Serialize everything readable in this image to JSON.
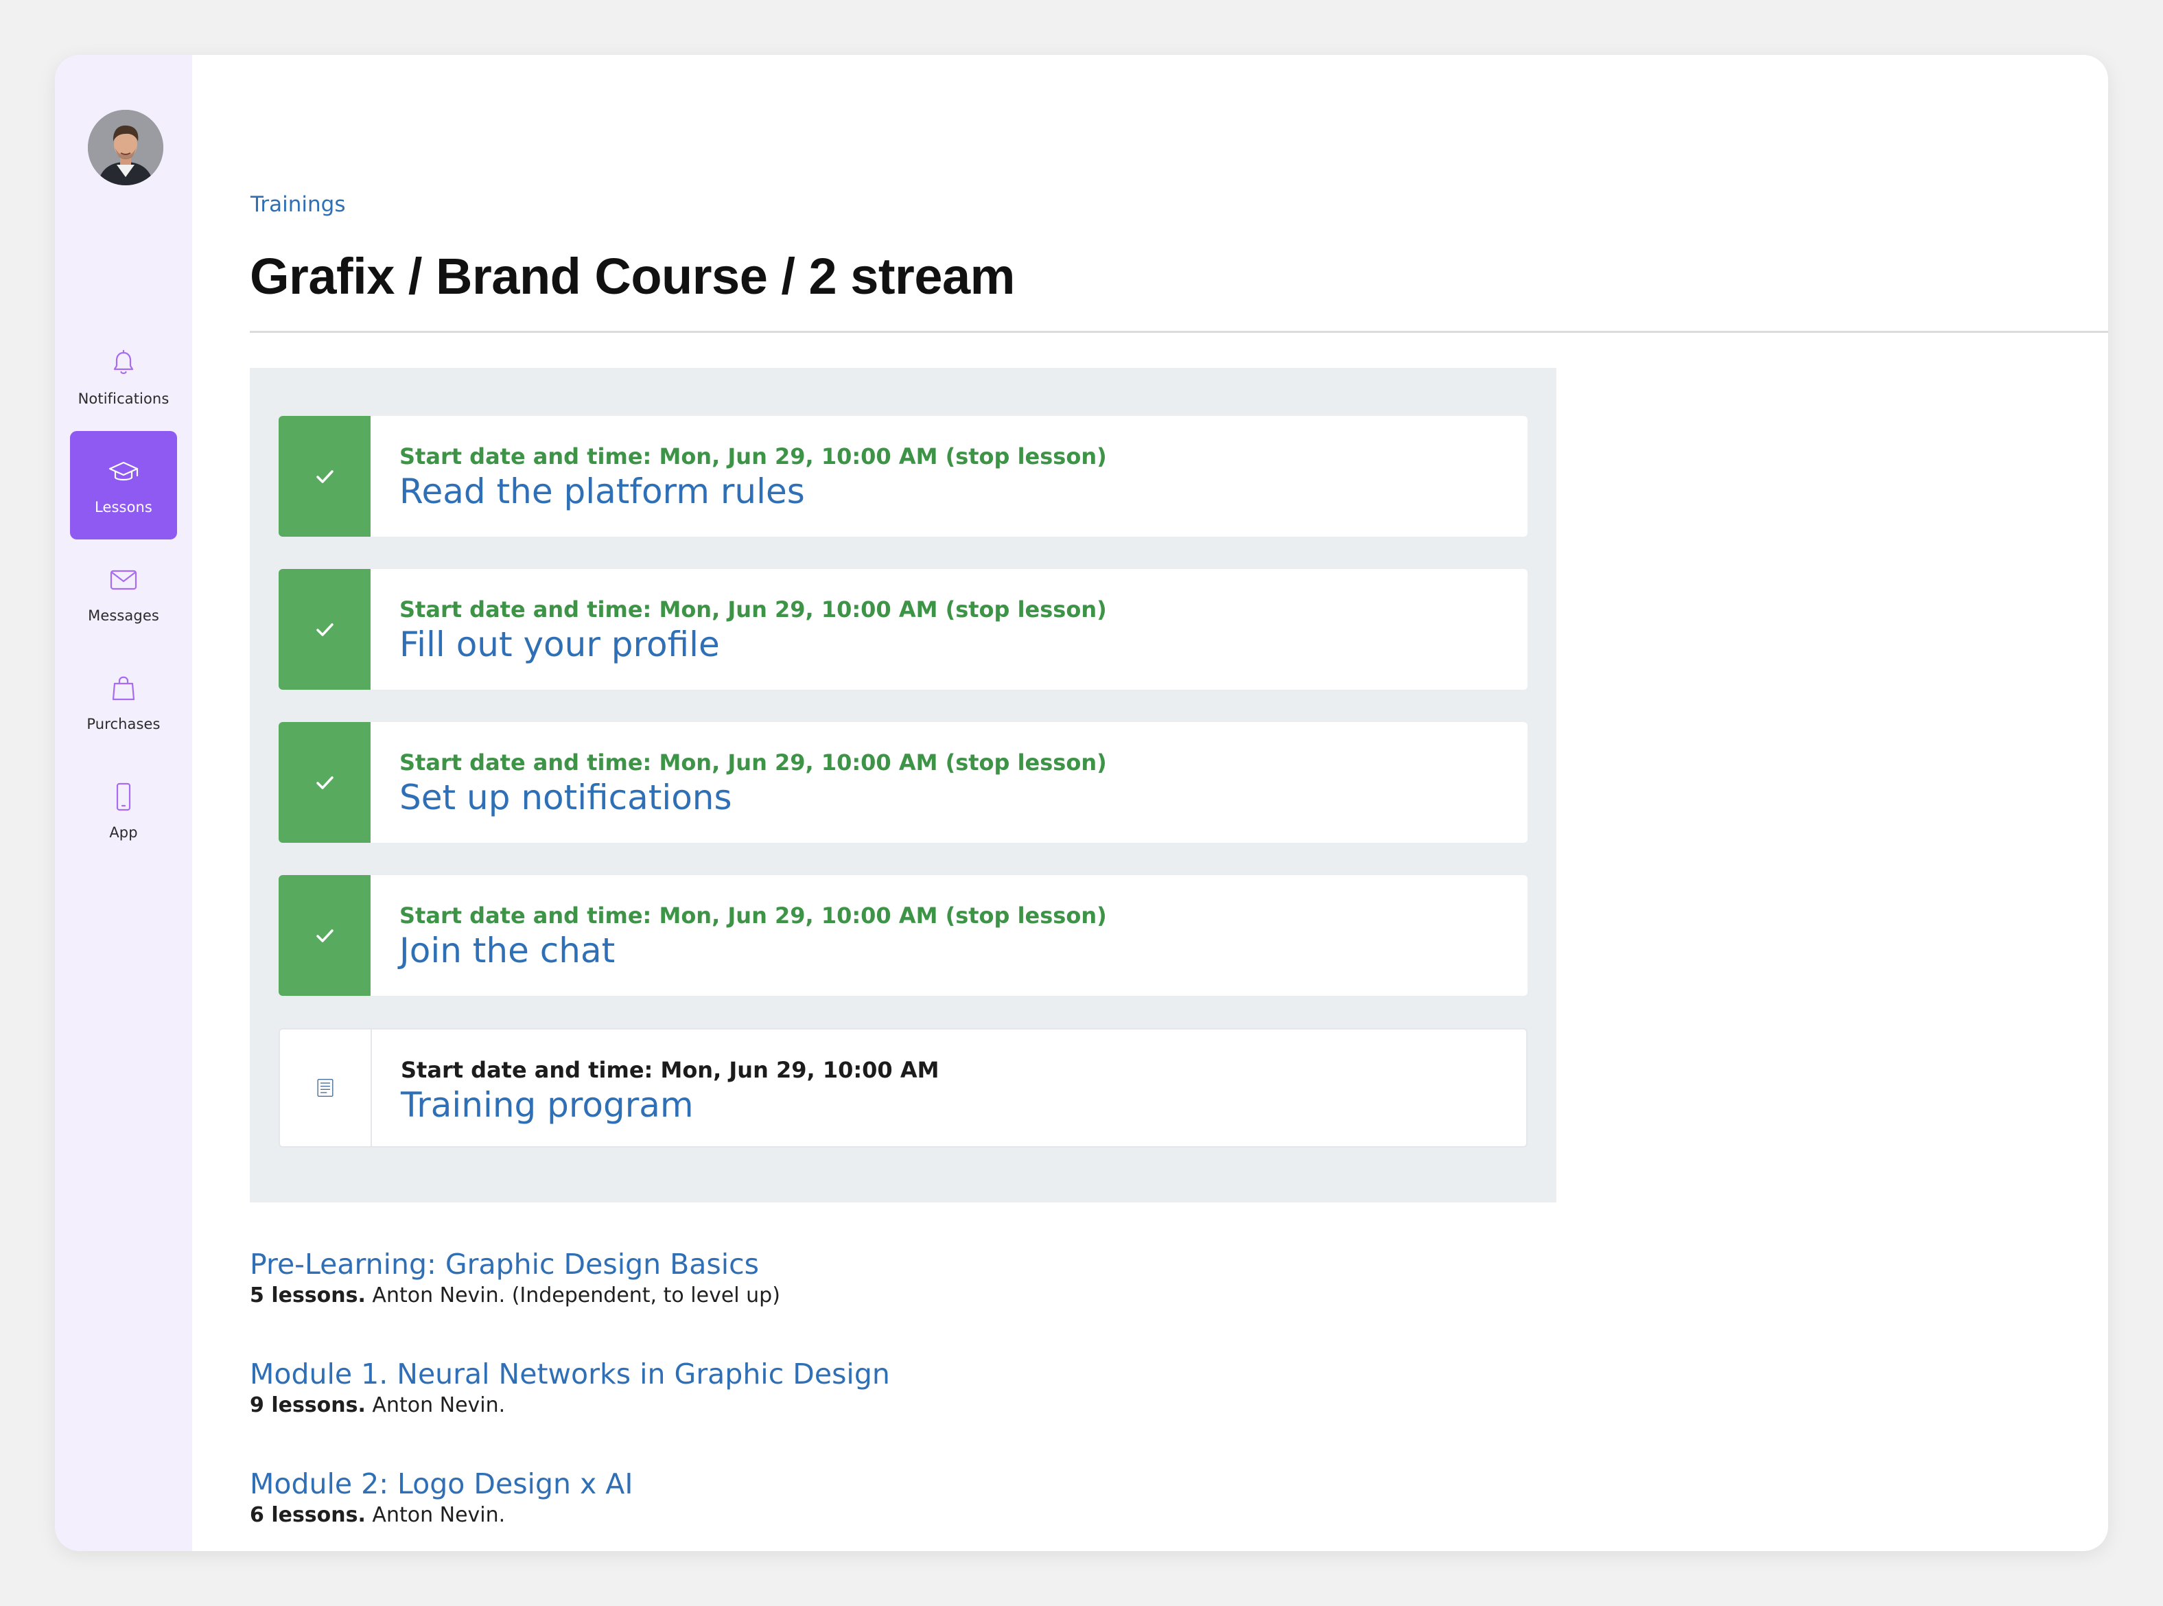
{
  "sidebar": {
    "items": [
      {
        "label": "Notifications",
        "icon": "bell-icon"
      },
      {
        "label": "Lessons",
        "icon": "graduation-cap-icon",
        "active": true
      },
      {
        "label": "Messages",
        "icon": "envelope-icon"
      },
      {
        "label": "Purchases",
        "icon": "shopping-bag-icon"
      },
      {
        "label": "App",
        "icon": "smartphone-icon"
      }
    ]
  },
  "header": {
    "breadcrumb": "Trainings",
    "title": "Grafix / Brand Course / 2 stream"
  },
  "lessons": [
    {
      "meta": "Start date and time: Mon, Jun 29, 10:00 AM (stop lesson)",
      "title": "Read the platform rules",
      "status": "completed"
    },
    {
      "meta": "Start date and time: Mon, Jun 29, 10:00 AM (stop lesson)",
      "title": "Fill out your profile",
      "status": "completed"
    },
    {
      "meta": "Start date and time: Mon, Jun 29, 10:00 AM (stop lesson)",
      "title": "Set up notifications",
      "status": "completed"
    },
    {
      "meta": "Start date and time: Mon, Jun 29, 10:00 AM (stop lesson)",
      "title": "Join the chat",
      "status": "completed"
    },
    {
      "meta": "Start date and time: Mon, Jun 29, 10:00 AM",
      "title": "Training program",
      "status": "pending"
    }
  ],
  "modules": [
    {
      "title": "Pre-Learning: Graphic Design Basics",
      "count": "5 lessons.",
      "details": " Anton Nevin.  (Independent, to level up)"
    },
    {
      "title": "Module 1. Neural Networks in Graphic Design",
      "count": "9 lessons.",
      "details": " Anton Nevin."
    },
    {
      "title": "Module 2: Logo Design x AI",
      "count": "6 lessons.",
      "details": " Anton Nevin."
    }
  ],
  "colors": {
    "accent": "#8f5af2",
    "sidebar_bg": "#f3effc",
    "link": "#2f6fb6",
    "success": "#58aa5e",
    "success_text": "#3d9447"
  }
}
